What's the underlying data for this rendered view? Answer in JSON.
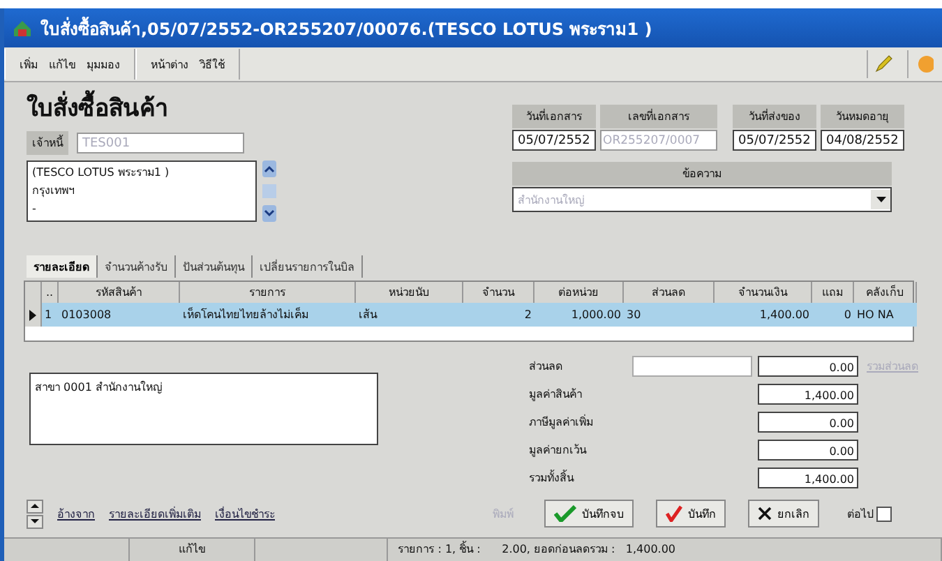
{
  "window": {
    "title": "ใบสั่งซื้อสินค้า,05/07/2552-OR255207/00076.(TESCO LOTUS พระราม1 )"
  },
  "menu": [
    [
      "เพิ่ม",
      "แก้ไข",
      "มุมมอง"
    ],
    [
      "หน้าต่าง",
      "วิธีใช้"
    ]
  ],
  "heading": "ใบสั่งซื้อสินค้า",
  "creditor": {
    "label": "เจ้าหนี้",
    "value": "TES001",
    "disabled": true
  },
  "address_lines": [
    "(TESCO LOTUS พระราม1 )",
    "กรุงเทพฯ",
    "-"
  ],
  "doc_fields": [
    {
      "label": "วันที่เอกสาร",
      "value": "05/07/2552",
      "disabled": false
    },
    {
      "label": "เลขที่เอกสาร",
      "value": "OR255207/0007",
      "disabled": true
    },
    {
      "label": "วันที่ส่งของ",
      "value": "05/07/2552",
      "disabled": false
    },
    {
      "label": "วันหมดอายุ",
      "value": "04/08/2552",
      "disabled": false
    }
  ],
  "branch": {
    "label": "ข้อความ",
    "value": "สำนักงานใหญ่",
    "disabled": true
  },
  "tabs": [
    {
      "label": "รายละเอียด",
      "selected": true
    },
    {
      "label": "จำนวนค้างรับ",
      "selected": false
    },
    {
      "label": "ปันส่วนต้นทุน",
      "selected": false
    },
    {
      "label": "เปลี่ยนรายการในบิล",
      "selected": false
    }
  ],
  "table": {
    "columns": [
      "..",
      "รหัสสินค้า",
      "รายการ",
      "หน่วยนับ",
      "จำนวน",
      "ต่อหน่วย",
      "ส่วนลด",
      "จำนวนเงิน",
      "แถม",
      "คลังเก็บ"
    ],
    "rows": [
      {
        "selected": true,
        "cells": [
          "1",
          "0103008",
          "เห็ดโคนไทยไทยล้างไม่เค็ม",
          "เส้น",
          "2",
          "1,000.00",
          "30",
          "1,400.00",
          "0",
          "HO NA"
        ]
      }
    ]
  },
  "memo": "สาขา 0001 สำนักงานใหญ่",
  "discount": {
    "label": "ส่วนลด",
    "value": "0.00",
    "link": "รวมส่วนลด",
    "link_disabled": true
  },
  "totals": [
    {
      "label": "มูลค่าสินค้า",
      "value": "1,400.00"
    },
    {
      "label": "ภาษีมูลค่าเพิ่ม",
      "value": "0.00"
    },
    {
      "label": "มูลค่ายกเว้น",
      "value": "0.00"
    },
    {
      "label": "รวมทั้งสิ้น",
      "value": "1,400.00"
    }
  ],
  "links": [
    "อ้างจาก",
    "รายละเอียดเพิ่มเติม",
    "เงื่อนไขชำระ"
  ],
  "print_button": {
    "label": "พิมพ์",
    "disabled": true
  },
  "buttons": [
    {
      "label": "บันทึกจบ",
      "kind": "save-close"
    },
    {
      "label": "บันทึก",
      "kind": "save"
    },
    {
      "label": "ยกเลิก",
      "kind": "cancel"
    }
  ],
  "next_checkbox": {
    "label": "ต่อไป",
    "checked": false
  },
  "status_bar": {
    "mode": "แก้ไข",
    "summary": "รายการ : 1, ชิ้น :      2.00, ยอดก่อนลดรวม :   1,400.00"
  }
}
